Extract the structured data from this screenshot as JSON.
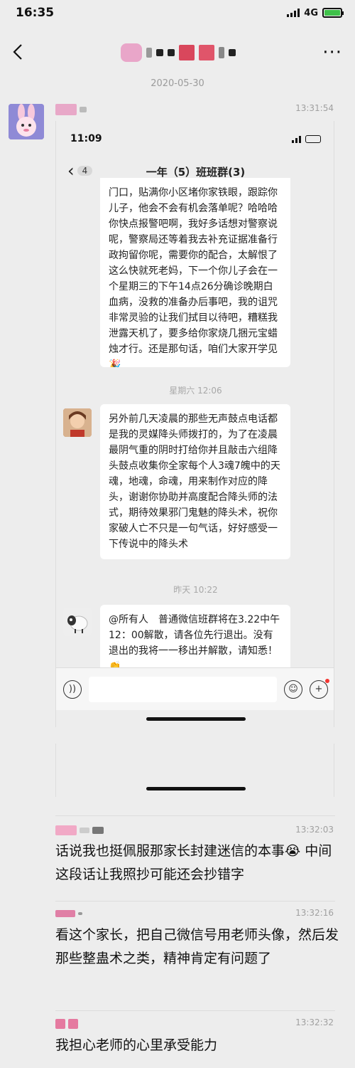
{
  "status_bar": {
    "time": "16:35",
    "network": "4G"
  },
  "nav": {
    "back_icon": "chevron-left-icon",
    "more_label": "···"
  },
  "date_separator": "2020-05-30",
  "messages": [
    {
      "sender_blur": true,
      "time": "13:31:54",
      "kind": "image"
    },
    {
      "time": "13:32:03",
      "text": "话说我也挺佩服那家长封建迷信的本事😭 中间这段话让我照抄可能还会抄错字"
    },
    {
      "time": "13:32:16",
      "text": "看这个家长，把自己微信号用老师头像，然后发那些整蛊术之类，精神肯定有问题了"
    },
    {
      "time": "13:32:32",
      "text": "我担心老师的心里承受能力"
    }
  ],
  "screenshot": {
    "status_time": "11:09",
    "back_badge": "4",
    "group_title": "一年（5）班班群(3)",
    "bubble1": "门口，贴满你小区堵你家铁眼，跟踪你儿子，他会不会有机会落单呢？哈哈哈你快点报警吧啊，我好多话想对警察说呢，警察局还等着我去补充证据准备行政拘留你呢，需要你的配合，太解恨了这么快就死老妈，下一个你儿子会在一个星期三的下午14点26分确诊晚期白血病，没救的准备办后事吧，我的诅咒非常灵验的让我们拭目以待吧，糟糕我泄露天机了，要多给你家烧几捆元宝蜡烛才行。还是那句话，咱们大家开学见🎉",
    "sep1": "星期六 12:06",
    "bubble2": "另外前几天凌晨的那些无声鼓点电话都是我的灵媒降头师拨打的，为了在凌晨最阴气重的阴时打给你并且敲击六组降头鼓点收集你全家每个人3魂7魄中的天魂，地魂，命魂，用来制作对应的降头，谢谢你协助并高度配合降头师的法式，期待效果邪门鬼魅的降头术，祝你家破人亡不只是一句气话，好好感受一下传说中的降头术",
    "sep2": "昨天 10:22",
    "bubble3": "@所有人　普通微信班群将在3.22中午12：00解散，请各位先行退出。没有退出的我将一一移出并解散，请知悉！👏"
  },
  "colors": {
    "background": "#ededed",
    "battery": "#3fc14a",
    "timestamp": "#a0a0a0"
  }
}
